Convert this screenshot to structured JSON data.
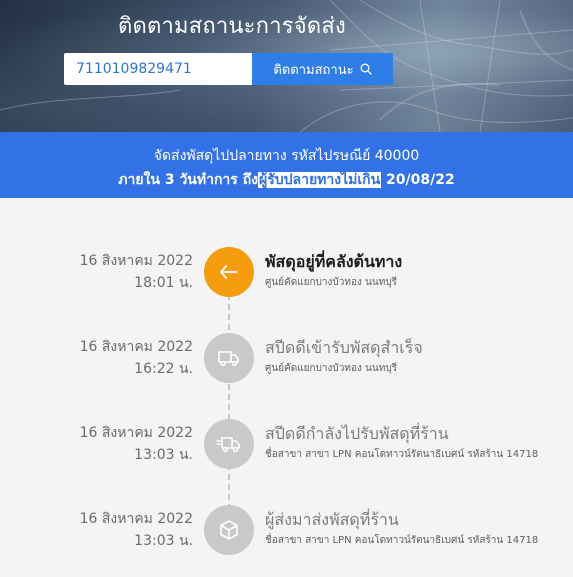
{
  "header": {
    "title": "ติดตามสถานะการจัดส่ง",
    "tracking_value": "7110109829471",
    "track_button_label": "ติดตามสถานะ",
    "track_button_icon": "search-icon"
  },
  "banner": {
    "line1": "จัดส่งพัสดุไปปลายทาง รหัสไปรษณีย์ 40000",
    "line2_prefix": "ภายใน 3 วันทำการ ถึง",
    "line2_highlight": "ผู้รับปลายทางไม่เกิน",
    "line2_suffix": " 20/08/22"
  },
  "colors": {
    "active": "#f59c0f",
    "inactive": "#c9c9c9",
    "banner": "#3372e6",
    "button": "#2f7ee8"
  },
  "events": [
    {
      "date": "16 สิงหาคม 2022",
      "time": "18:01 น.",
      "title": "พัสดุอยู่ที่คลังต้นทาง",
      "subtitle": "ศูนย์คัดแยกบางบัวทอง นนทบุรี",
      "icon": "arrow-left-icon",
      "active": true
    },
    {
      "date": "16 สิงหาคม 2022",
      "time": "16:22 น.",
      "title": "สปีดดีเข้ารับพัสดุสำเร็จ",
      "subtitle": "ศูนย์คัดแยกบางบัวทอง นนทบุรี",
      "icon": "truck-icon",
      "active": false
    },
    {
      "date": "16 สิงหาคม 2022",
      "time": "13:03 น.",
      "title": "สปีดดีกำลังไปรับพัสดุที่ร้าน",
      "subtitle": "ชื่อสาขา สาขา LPN คอนโดทาวน์รัตนาธิเบศน์ รหัสร้าน 14718",
      "icon": "moving-truck-icon",
      "active": false
    },
    {
      "date": "16 สิงหาคม 2022",
      "time": "13:03 น.",
      "title": "ผู้ส่งมาส่งพัสดุที่ร้าน",
      "subtitle": "ชื่อสาขา สาขา LPN คอนโดทาวน์รัตนาธิเบศน์ รหัสร้าน 14718",
      "icon": "box-icon",
      "active": false
    }
  ]
}
